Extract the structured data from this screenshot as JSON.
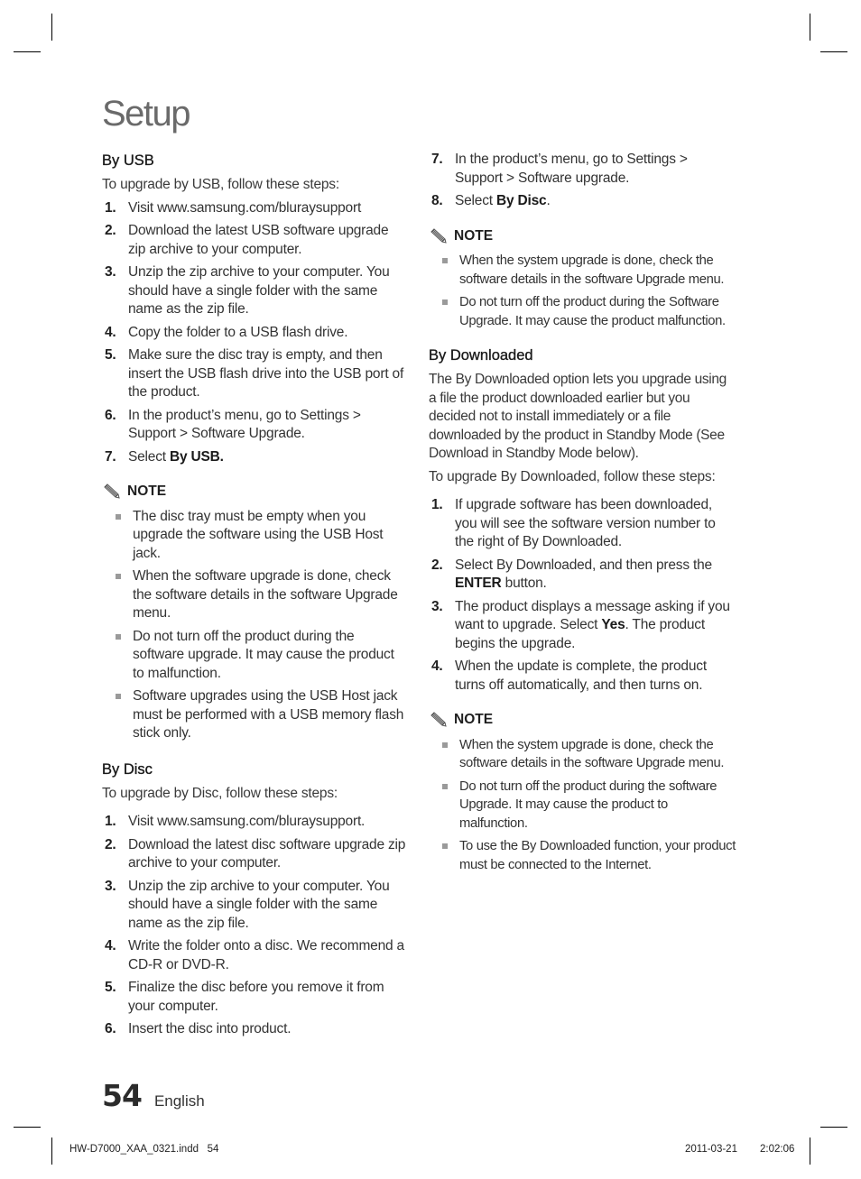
{
  "page_title": "Setup",
  "left_column": {
    "by_usb": {
      "heading": "By USB",
      "intro": "To upgrade by USB, follow these steps:",
      "steps": [
        {
          "num": "1.",
          "text": "Visit www.samsung.com/bluraysupport"
        },
        {
          "num": "2.",
          "text": "Download the latest USB software upgrade zip archive to your computer."
        },
        {
          "num": "3.",
          "text": "Unzip the zip archive to your computer. You should have a single folder with the same name as the zip file."
        },
        {
          "num": "4.",
          "text": "Copy the folder to a USB flash drive."
        },
        {
          "num": "5.",
          "text": "Make sure the disc tray is empty, and then insert the USB flash drive into the USB port of the product."
        },
        {
          "num": "6.",
          "text": "In the product’s menu, go to Settings > Support > Software Upgrade."
        },
        {
          "num": "7.",
          "text_prefix": "Select ",
          "text_bold": "By USB."
        }
      ],
      "note": {
        "label": "NOTE",
        "icon": "pencil-note-icon",
        "items": [
          "The disc tray must be empty when you upgrade the software using the USB Host jack.",
          "When the software upgrade is done, check the software details in the software Upgrade menu.",
          "Do not turn off the product during the software upgrade. It may cause the product to malfunction.",
          "Software upgrades using the USB Host jack must be performed with a USB memory flash stick only."
        ]
      }
    },
    "by_disc": {
      "heading": "By Disc",
      "intro": "To upgrade by Disc, follow these steps:",
      "steps": [
        {
          "num": "1.",
          "text": "Visit www.samsung.com/bluraysupport."
        },
        {
          "num": "2.",
          "text": "Download the latest disc software upgrade zip archive to your computer."
        },
        {
          "num": "3.",
          "text": "Unzip the zip archive to your computer. You should have a single folder with the same name as the zip file."
        },
        {
          "num": "4.",
          "text": "Write the folder onto a disc. We recommend a CD-R or DVD-R."
        },
        {
          "num": "5.",
          "text": "Finalize the disc before you remove it from your computer."
        },
        {
          "num": "6.",
          "text": "Insert the disc into product."
        }
      ]
    }
  },
  "right_column": {
    "by_disc_cont": {
      "steps": [
        {
          "num": "7.",
          "text": "In the product’s menu, go to Settings > Support > Software upgrade."
        },
        {
          "num": "8.",
          "text_prefix": "Select ",
          "text_bold": "By Disc",
          "text_suffix": "."
        }
      ],
      "note": {
        "label": "NOTE",
        "icon": "pencil-note-icon",
        "items": [
          "When the system upgrade is done, check the software details in the software Upgrade menu.",
          "Do not turn off the product during the Software Upgrade. It may cause the product malfunction."
        ]
      }
    },
    "by_downloaded": {
      "heading": "By Downloaded",
      "description": "The By Downloaded option lets you upgrade using a file the product downloaded earlier but you decided not to install immediately or a file downloaded by the product in Standby Mode (See Download in Standby Mode below).",
      "intro": "To upgrade By Downloaded, follow these steps:",
      "steps": [
        {
          "num": "1.",
          "text": "If upgrade software has been downloaded, you will see the software version number to the right of By Downloaded."
        },
        {
          "num": "2.",
          "text_prefix": "Select By Downloaded, and then press the ",
          "text_bold": "ENTER",
          "text_suffix": " button."
        },
        {
          "num": "3.",
          "text_prefix": "The product displays a message asking if you want to upgrade. Select ",
          "text_bold": "Yes",
          "text_suffix": ". The product begins the upgrade."
        },
        {
          "num": "4.",
          "text": "When the update is complete, the product turns off automatically, and then turns on."
        }
      ],
      "note": {
        "label": "NOTE",
        "icon": "pencil-note-icon",
        "items": [
          "When the system upgrade is done, check the software details in the software Upgrade menu.",
          "Do not turn off the product during the software Upgrade. It may cause the product to malfunction.",
          "To use the By Downloaded function, your product must be connected to the Internet."
        ]
      }
    }
  },
  "footer": {
    "page_number": "54",
    "language": "English",
    "slug_file": "HW-D7000_XAA_0321.indd   54",
    "slug_date": "2011-03-21",
    "slug_time": "2:02:06"
  }
}
